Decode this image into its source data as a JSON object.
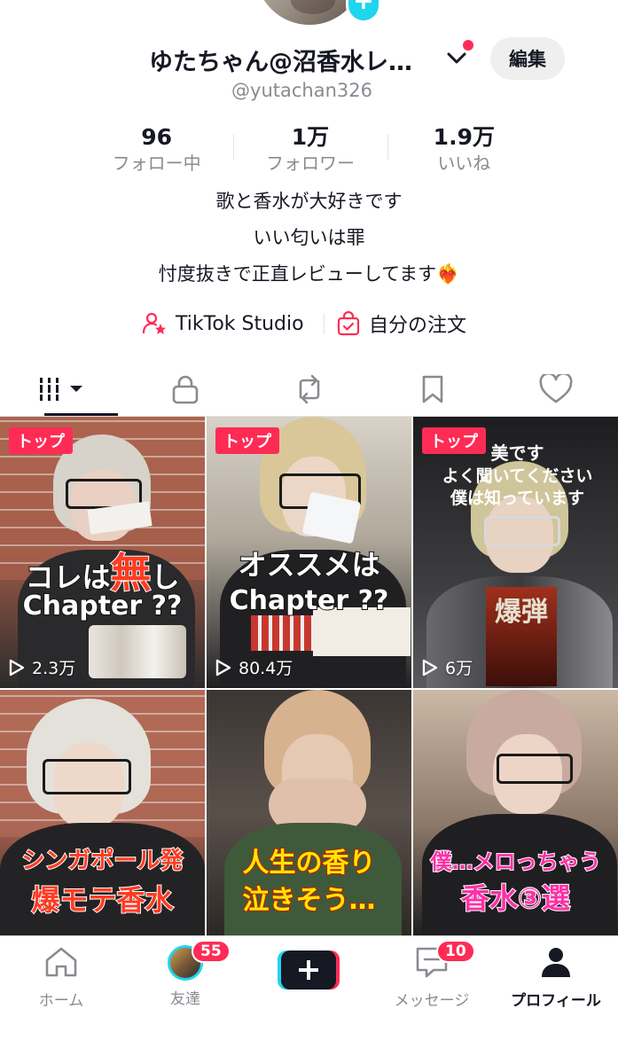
{
  "profile": {
    "display_name": "ゆたちゃん@沼香水レ…",
    "handle": "@yutachan326",
    "edit_label": "編集"
  },
  "stats": [
    {
      "value": "96",
      "label": "フォロー中"
    },
    {
      "value": "1万",
      "label": "フォロワー"
    },
    {
      "value": "1.9万",
      "label": "いいね"
    }
  ],
  "bio": {
    "line1": "歌と香水が大好きです",
    "line2": "いい匂いは罪",
    "line3": "忖度抜きで正直レビューしてます❤️‍🔥"
  },
  "links": {
    "studio": "TikTok Studio",
    "orders": "自分の注文"
  },
  "videos": [
    {
      "badge": "トップ",
      "views": "2.3万",
      "caption1": "コレは",
      "caption_em": "無",
      "caption1b": "し",
      "caption2": "Chapter ??"
    },
    {
      "badge": "トップ",
      "views": "80.4万",
      "caption1": "オススメは",
      "caption2": "Chapter ??"
    },
    {
      "badge": "トップ",
      "views": "6万",
      "overlay1": "美です",
      "overlay2": "よく聞いてください",
      "overlay3": "僕は知っています",
      "poster": "爆弾"
    },
    {
      "caption1": "シンガポール発",
      "caption2": "爆モテ香水"
    },
    {
      "caption1": "人生の香り",
      "caption2": "泣きそう…"
    },
    {
      "caption1": "僕…メロっちゃう",
      "caption2": "香水③選"
    }
  ],
  "nav": {
    "home": "ホーム",
    "friends": "友達",
    "friends_badge": "55",
    "messages": "メッセージ",
    "messages_badge": "10",
    "profile": "プロフィール"
  },
  "colors": {
    "accent": "#fe2c55",
    "cyan": "#20d5ec",
    "text": "#161823",
    "muted": "#8a8b91"
  }
}
